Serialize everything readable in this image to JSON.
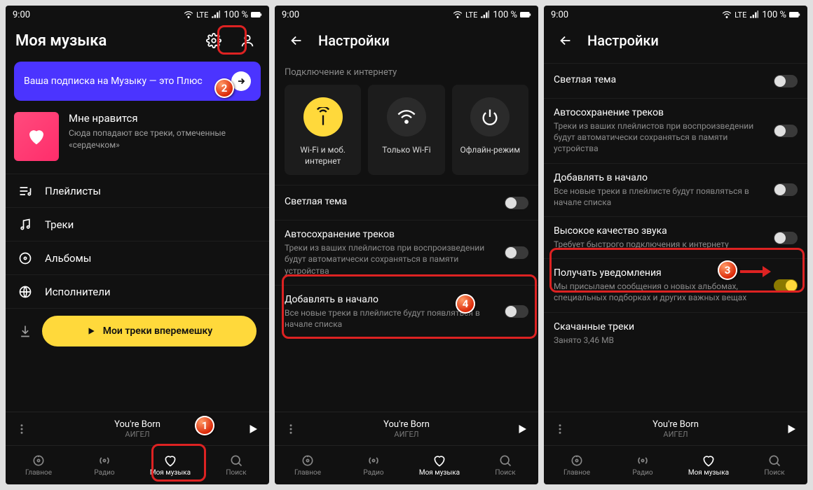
{
  "status": {
    "time": "9:00",
    "lte": "LTE",
    "battery": "100 %"
  },
  "screen1": {
    "title": "Моя музыка",
    "banner": "Ваша подписка на Музыку — это Плюс",
    "liked_title": "Мне нравится",
    "liked_sub": "Сюда попадают все треки, отмеченные «сердечком»",
    "menu": {
      "playlists": "Плейлисты",
      "tracks": "Треки",
      "albums": "Альбомы",
      "artists": "Исполнители"
    },
    "shuffle": "Мои треки вперемешку"
  },
  "settings_title": "Настройки",
  "conn_section": "Подключение к интернету",
  "conn": {
    "wifi_mob": "Wi-Fi и моб. интернет",
    "wifi_only": "Только Wi-Fi",
    "offline": "Офлайн-режим"
  },
  "opts": {
    "light_theme": {
      "t": "Светлая тема"
    },
    "autosave": {
      "t": "Автосохранение треков",
      "s": "Треки из ваших плейлистов при воспроизведении будут автоматически сохраняться в памяти устройства"
    },
    "add_begin": {
      "t": "Добавлять в начало",
      "s": "Все новые треки в плейлисте будут появляться в начале списка"
    },
    "hq": {
      "t": "Высокое качество звука",
      "s": "Требует быстрого подключения к интернету"
    },
    "notif": {
      "t": "Получать уведомления",
      "s": "Мы присылаем сообщения о новых альбомах, специальных подборках и других важных вещах"
    },
    "downloaded": {
      "t": "Скачанные треки",
      "s": "Занято 3,46 MB"
    }
  },
  "nowplaying": {
    "song": "You're Born",
    "artist": "АИГЕЛ"
  },
  "nav": {
    "home": "Главное",
    "radio": "Радио",
    "mymusic": "Моя музыка",
    "search": "Поиск"
  },
  "badges": {
    "b1": "1",
    "b2": "2",
    "b3": "3",
    "b4": "4"
  }
}
